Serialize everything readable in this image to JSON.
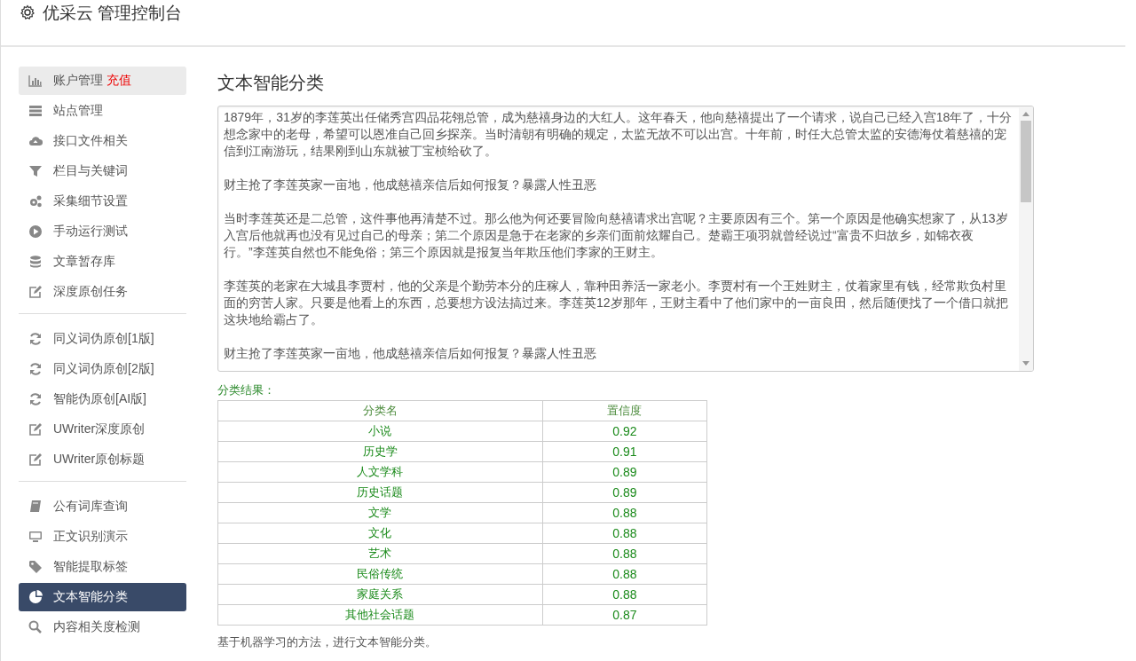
{
  "header": {
    "title": "优采云 管理控制台"
  },
  "sidebar": {
    "groups": [
      {
        "items": [
          {
            "label": "账户管理",
            "badge": "充值",
            "selected": false,
            "hovered": true
          },
          {
            "label": "站点管理",
            "selected": false,
            "hovered": false
          },
          {
            "label": "接口文件相关",
            "selected": false,
            "hovered": false
          },
          {
            "label": "栏目与关键词",
            "selected": false,
            "hovered": false
          },
          {
            "label": "采集细节设置",
            "selected": false,
            "hovered": false
          },
          {
            "label": "手动运行测试",
            "selected": false,
            "hovered": false
          },
          {
            "label": "文章暂存库",
            "selected": false,
            "hovered": false
          },
          {
            "label": "深度原创任务",
            "selected": false,
            "hovered": false
          }
        ]
      },
      {
        "items": [
          {
            "label": "同义词伪原创[1版]",
            "selected": false,
            "hovered": false
          },
          {
            "label": "同义词伪原创[2版]",
            "selected": false,
            "hovered": false
          },
          {
            "label": "智能伪原创[AI版]",
            "selected": false,
            "hovered": false
          },
          {
            "label": "UWriter深度原创",
            "selected": false,
            "hovered": false
          },
          {
            "label": "UWriter原创标题",
            "selected": false,
            "hovered": false
          }
        ]
      },
      {
        "items": [
          {
            "label": "公有词库查询",
            "selected": false,
            "hovered": false
          },
          {
            "label": "正文识别演示",
            "selected": false,
            "hovered": false
          },
          {
            "label": "智能提取标签",
            "selected": false,
            "hovered": false
          },
          {
            "label": "文本智能分类",
            "selected": true,
            "hovered": false
          },
          {
            "label": "内容相关度检测",
            "selected": false,
            "hovered": false
          }
        ]
      }
    ]
  },
  "main": {
    "title": "文本智能分类",
    "text_input": {
      "paragraphs": [
        "1879年，31岁的李莲英出任储秀宫四品花翎总管，成为慈禧身边的大红人。这年春天，他向慈禧提出了一个请求，说自己已经入宫18年了，十分想念家中的老母，希望可以恩准自己回乡探亲。当时清朝有明确的规定，太监无故不可以出宫。十年前，时任大总管太监的安德海仗着慈禧的宠信到江南游玩，结果刚到山东就被丁宝桢给砍了。",
        "财主抢了李莲英家一亩地，他成慈禧亲信后如何报复？暴露人性丑恶",
        "当时李莲英还是二总管，这件事他再清楚不过。那么他为何还要冒险向慈禧请求出宫呢？主要原因有三个。第一个原因是他确实想家了，从13岁入宫后他就再也没有见过自己的母亲；第二个原因是急于在老家的乡亲们面前炫耀自己。楚霸王项羽就曾经说过“富贵不归故乡，如锦衣夜行。”李莲英自然也不能免俗；第三个原因就是报复当年欺压他们李家的王财主。",
        "李莲英的老家在大城县李贾村，他的父亲是个勤劳本分的庄稼人，靠种田养活一家老小。李贾村有一个王姓财主，仗着家里有钱，经常欺负村里面的穷苦人家。只要是他看上的东西，总要想方设法搞过来。李莲英12岁那年，王财主看中了他们家中的一亩良田，然后随便找了一个借口就把这块地给霸占了。",
        "财主抢了李莲英家一亩地，他成慈禧亲信后如何报复？暴露人性丑恶"
      ]
    },
    "result_label": "分类结果：",
    "table": {
      "columns": [
        "分类名",
        "置信度"
      ],
      "rows": [
        [
          "小说",
          "0.92"
        ],
        [
          "历史学",
          "0.91"
        ],
        [
          "人文学科",
          "0.89"
        ],
        [
          "历史话题",
          "0.89"
        ],
        [
          "文学",
          "0.88"
        ],
        [
          "文化",
          "0.88"
        ],
        [
          "艺术",
          "0.88"
        ],
        [
          "民俗传统",
          "0.88"
        ],
        [
          "家庭关系",
          "0.88"
        ],
        [
          "其他社会话题",
          "0.87"
        ]
      ]
    },
    "note": "基于机器学习的方法，进行文本智能分类。"
  }
}
